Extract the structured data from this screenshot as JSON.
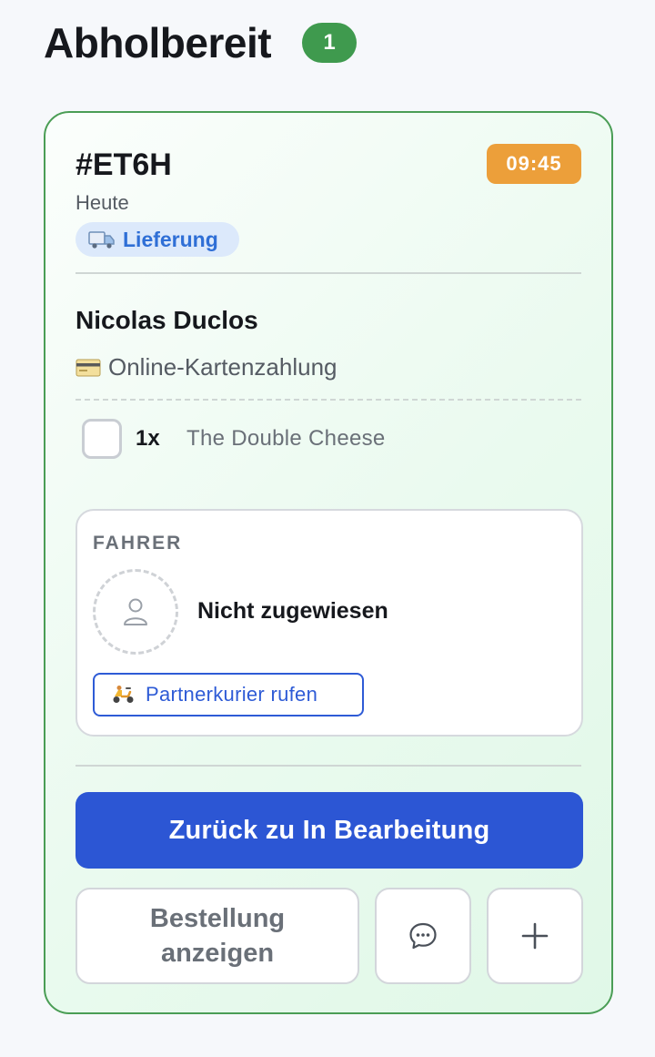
{
  "section": {
    "title": "Abholbereit",
    "count": "1"
  },
  "order": {
    "id": "#ET6H",
    "time": "09:45",
    "date": "Heute",
    "type_label": "Lieferung",
    "type_icon": "delivery-truck-icon",
    "customer_name": "Nicolas Duclos",
    "payment_icon": "credit-card-icon",
    "payment_method": "Online-Kartenzahlung",
    "items": [
      {
        "quantity": "1x",
        "name": "The Double Cheese",
        "checked": false
      }
    ]
  },
  "driver": {
    "heading": "FAHRER",
    "avatar_icon": "user-placeholder-icon",
    "status": "Nicht zugewiesen",
    "courier_icon": "scooter-icon",
    "courier_button_label": "Partnerkurier rufen"
  },
  "actions": {
    "primary_label": "Zurück zu In Bearbeitung",
    "show_order_line1": "Bestellung",
    "show_order_line2": "anzeigen",
    "chat_icon": "chat-bubble-icon",
    "add_icon": "plus-icon"
  },
  "colors": {
    "badge_green": "#3f9a4e",
    "card_border": "#4a9d55",
    "time_badge": "#ec9f3a",
    "delivery_pill_bg": "#dce9fb",
    "delivery_pill_text": "#2f6fd6",
    "primary_blue": "#2c56d4"
  }
}
